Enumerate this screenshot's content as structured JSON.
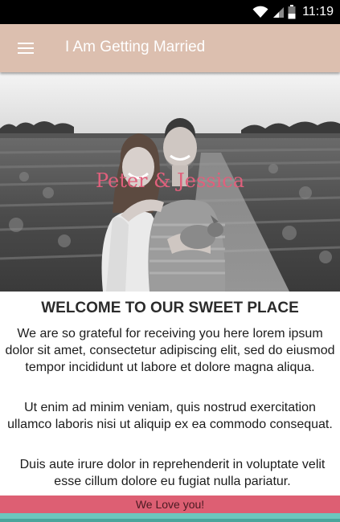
{
  "status_bar": {
    "time": "11:19",
    "icons": [
      "wifi-icon",
      "signal-icon",
      "battery-icon"
    ]
  },
  "app_bar": {
    "title": "I Am Getting Married",
    "menu_icon": "hamburger-menu-icon",
    "background_color": "#dcbfaf"
  },
  "hero": {
    "names": "Peter & Jessica",
    "names_color": "#e0607c"
  },
  "content": {
    "heading": "WELCOME TO OUR SWEET PLACE",
    "paragraphs": [
      "We are so grateful for receiving you here lorem ipsum dolor sit amet, consectetur adipiscing elit, sed do eiusmod tempor incididunt ut labore et dolore magna aliqua.",
      "Ut enim ad minim veniam, quis nostrud exercitation ullamco laboris nisi ut aliquip ex ea commodo consequat.",
      "Duis aute irure dolor in reprehenderit in voluptate velit esse cillum dolore eu fugiat nulla pariatur."
    ]
  },
  "footer": {
    "text": "We Love you!",
    "band_color": "#dd5f73",
    "strip_color": "#6cc7bd"
  }
}
